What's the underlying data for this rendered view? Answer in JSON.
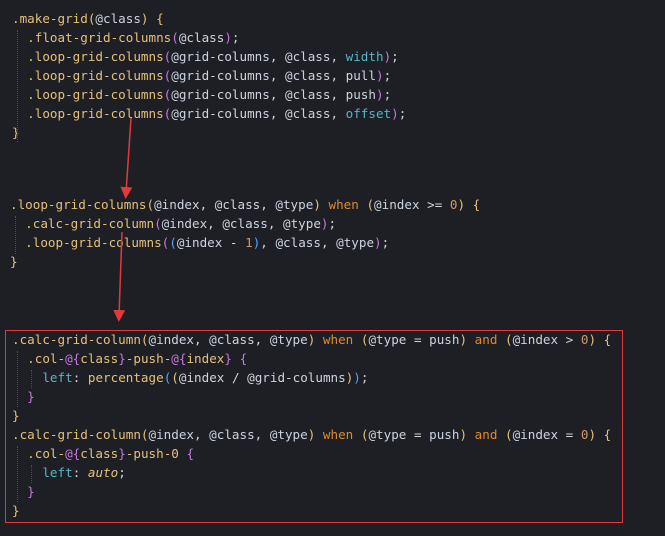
{
  "block1": {
    "lines": [
      ".make-grid(@class) {",
      "  .float-grid-columns(@class);",
      "  .loop-grid-columns(@grid-columns, @class, width);",
      "  .loop-grid-columns(@grid-columns, @class, pull);",
      "  .loop-grid-columns(@grid-columns, @class, push);",
      "  .loop-grid-columns(@grid-columns, @class, offset);",
      "}"
    ]
  },
  "block2": {
    "lines": [
      ".loop-grid-columns(@index, @class, @type) when (@index >= 0) {",
      "  .calc-grid-column(@index, @class, @type);",
      "  .loop-grid-columns((@index - 1), @class, @type);",
      "}"
    ]
  },
  "block3": {
    "lines": [
      ".calc-grid-column(@index, @class, @type) when (@type = push) and (@index > 0) {",
      "  .col-@{class}-push-@{index} {",
      "    left: percentage((@index / @grid-columns));",
      "  }",
      "}",
      ".calc-grid-column(@index, @class, @type) when (@type = push) and (@index = 0) {",
      "  .col-@{class}-push-0 {",
      "    left: auto;",
      "  }",
      "}"
    ]
  },
  "colors": {
    "background": "#1e1f25",
    "annotation": "#e23a3a"
  }
}
